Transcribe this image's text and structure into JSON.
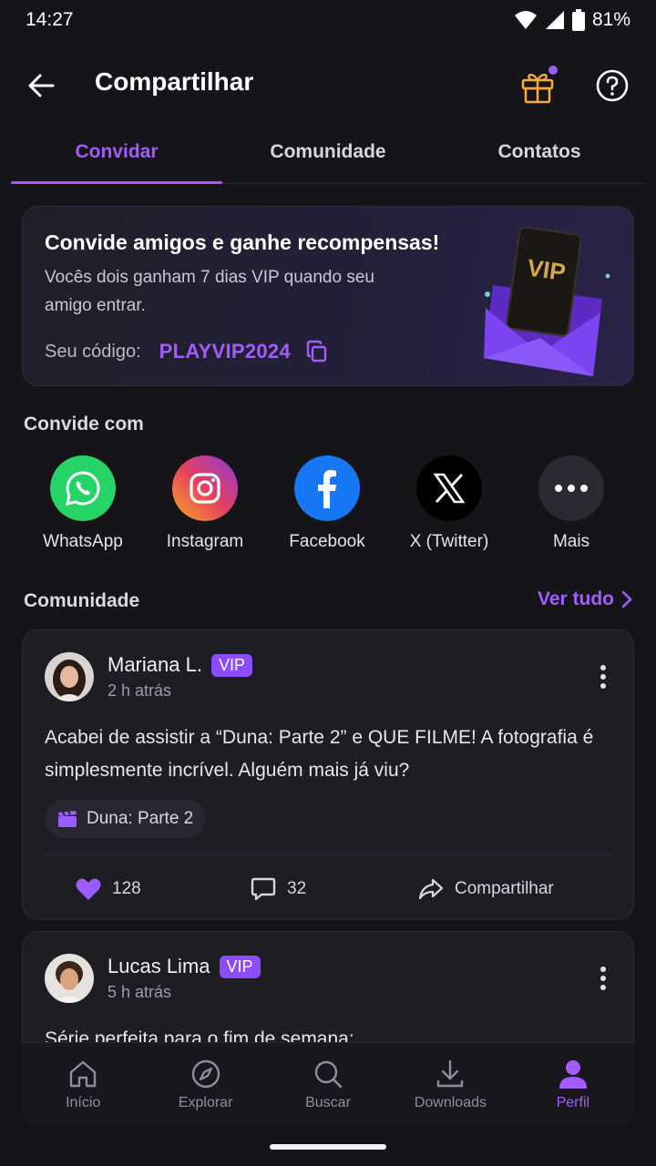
{
  "status_bar": {
    "time": "14:27",
    "battery": "81%"
  },
  "app_bar": {
    "title": "Compartilhar"
  },
  "tabs": [
    {
      "label": "Convidar",
      "active": true
    },
    {
      "label": "Comunidade",
      "active": false
    },
    {
      "label": "Contatos",
      "active": false
    }
  ],
  "invite": {
    "title": "Convide amigos e ganhe recompensas!",
    "description": "Vocês dois ganham 7 dias VIP quando seu amigo entrar.",
    "code_label": "Seu código:",
    "code_value": "PLAYVIP2024",
    "illustration_text": "VIP"
  },
  "share_section": {
    "title": "Convide com",
    "items": [
      {
        "label": "WhatsApp",
        "icon": "whatsapp-icon",
        "color": "#25d366"
      },
      {
        "label": "Instagram",
        "icon": "instagram-icon",
        "color": "#dd2a7b"
      },
      {
        "label": "Facebook",
        "icon": "facebook-icon",
        "color": "#1877f2"
      },
      {
        "label": "X (Twitter)",
        "icon": "x-icon",
        "color": "#000000"
      },
      {
        "label": "Mais",
        "icon": "more-icon",
        "color": "#2a2a33"
      }
    ]
  },
  "community": {
    "title": "Comunidade",
    "see_all": "Ver tudo",
    "posts": [
      {
        "author": "Mariana L.",
        "badge": "VIP",
        "time": "2 h atrás",
        "text": "Acabei de assistir a “Duna: Parte 2” e QUE FILME! A fotografia é simplesmente incrível. Alguém mais já viu?",
        "chip": "Duna: Parte 2",
        "likes": "128",
        "comments": "32",
        "share_label": "Compartilhar"
      },
      {
        "author": "Lucas Lima",
        "badge": "VIP",
        "time": "5 h atrás",
        "text": "Série perfeita para o fim de semana:"
      }
    ]
  },
  "bottom_nav": [
    {
      "label": "Início",
      "icon": "home-icon",
      "active": false
    },
    {
      "label": "Explorar",
      "icon": "compass-icon",
      "active": false
    },
    {
      "label": "Buscar",
      "icon": "search-icon",
      "active": false
    },
    {
      "label": "Downloads",
      "icon": "download-icon",
      "active": false
    },
    {
      "label": "Perfil",
      "icon": "profile-icon",
      "active": true
    }
  ],
  "colors": {
    "accent": "#a45cff",
    "background": "#141419",
    "card": "#1d1d24"
  }
}
